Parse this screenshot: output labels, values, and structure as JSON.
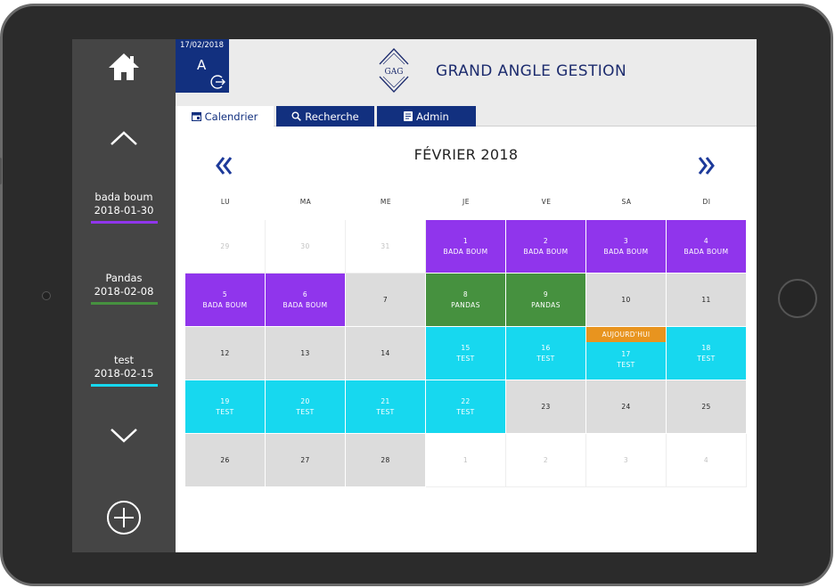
{
  "header": {
    "date": "17/02/2018",
    "user_initial": "A",
    "logo_text": "GAG",
    "brand": "GRAND ANGLE GESTION"
  },
  "tabs": [
    {
      "label": "Calendrier",
      "icon": "calendar-icon",
      "active": true
    },
    {
      "label": "Recherche",
      "icon": "search-icon",
      "active": false
    },
    {
      "label": "Admin",
      "icon": "document-icon",
      "active": false
    }
  ],
  "sidebar": {
    "events": [
      {
        "name": "bada boum",
        "date": "2018-01-30",
        "color": "#9035ec"
      },
      {
        "name": "Pandas",
        "date": "2018-02-08",
        "color": "#46913f"
      },
      {
        "name": "test",
        "date": "2018-02-15",
        "color": "#17d8ef"
      }
    ]
  },
  "calendar": {
    "title": "FÉVRIER 2018",
    "prev_symbol": "«",
    "next_symbol": "»",
    "weekdays": [
      "LU",
      "MA",
      "ME",
      "JE",
      "VE",
      "SA",
      "DI"
    ],
    "today_label": "AUJOURD'HUI",
    "weeks": [
      [
        {
          "day": "29",
          "label": "",
          "style": "muted"
        },
        {
          "day": "30",
          "label": "",
          "style": "muted"
        },
        {
          "day": "31",
          "label": "",
          "style": "muted"
        },
        {
          "day": "1",
          "label": "BADA BOUM",
          "style": "purple"
        },
        {
          "day": "2",
          "label": "BADA BOUM",
          "style": "purple"
        },
        {
          "day": "3",
          "label": "BADA BOUM",
          "style": "purple"
        },
        {
          "day": "4",
          "label": "BADA BOUM",
          "style": "purple"
        }
      ],
      [
        {
          "day": "5",
          "label": "BADA BOUM",
          "style": "purple"
        },
        {
          "day": "6",
          "label": "BADA BOUM",
          "style": "purple"
        },
        {
          "day": "7",
          "label": "",
          "style": "grey"
        },
        {
          "day": "8",
          "label": "PANDAS",
          "style": "green"
        },
        {
          "day": "9",
          "label": "PANDAS",
          "style": "green"
        },
        {
          "day": "10",
          "label": "",
          "style": "grey"
        },
        {
          "day": "11",
          "label": "",
          "style": "grey"
        }
      ],
      [
        {
          "day": "12",
          "label": "",
          "style": "grey"
        },
        {
          "day": "13",
          "label": "",
          "style": "grey"
        },
        {
          "day": "14",
          "label": "",
          "style": "grey"
        },
        {
          "day": "15",
          "label": "TEST",
          "style": "cyan"
        },
        {
          "day": "16",
          "label": "TEST",
          "style": "cyan"
        },
        {
          "day": "17",
          "label": "TEST",
          "style": "cyan",
          "today": true
        },
        {
          "day": "18",
          "label": "TEST",
          "style": "cyan"
        }
      ],
      [
        {
          "day": "19",
          "label": "TEST",
          "style": "cyan"
        },
        {
          "day": "20",
          "label": "TEST",
          "style": "cyan"
        },
        {
          "day": "21",
          "label": "TEST",
          "style": "cyan"
        },
        {
          "day": "22",
          "label": "TEST",
          "style": "cyan"
        },
        {
          "day": "23",
          "label": "",
          "style": "grey"
        },
        {
          "day": "24",
          "label": "",
          "style": "grey"
        },
        {
          "day": "25",
          "label": "",
          "style": "grey"
        }
      ],
      [
        {
          "day": "26",
          "label": "",
          "style": "grey"
        },
        {
          "day": "27",
          "label": "",
          "style": "grey"
        },
        {
          "day": "28",
          "label": "",
          "style": "grey"
        },
        {
          "day": "1",
          "label": "",
          "style": "muted"
        },
        {
          "day": "2",
          "label": "",
          "style": "muted"
        },
        {
          "day": "3",
          "label": "",
          "style": "muted"
        },
        {
          "day": "4",
          "label": "",
          "style": "muted"
        }
      ]
    ]
  },
  "colors": {
    "navy": "#12307f",
    "sidebar": "#454545",
    "purple": "#9035ec",
    "green": "#46913f",
    "cyan": "#17d8ef",
    "today": "#e8941f",
    "grey_cell": "#dcdcdc"
  }
}
